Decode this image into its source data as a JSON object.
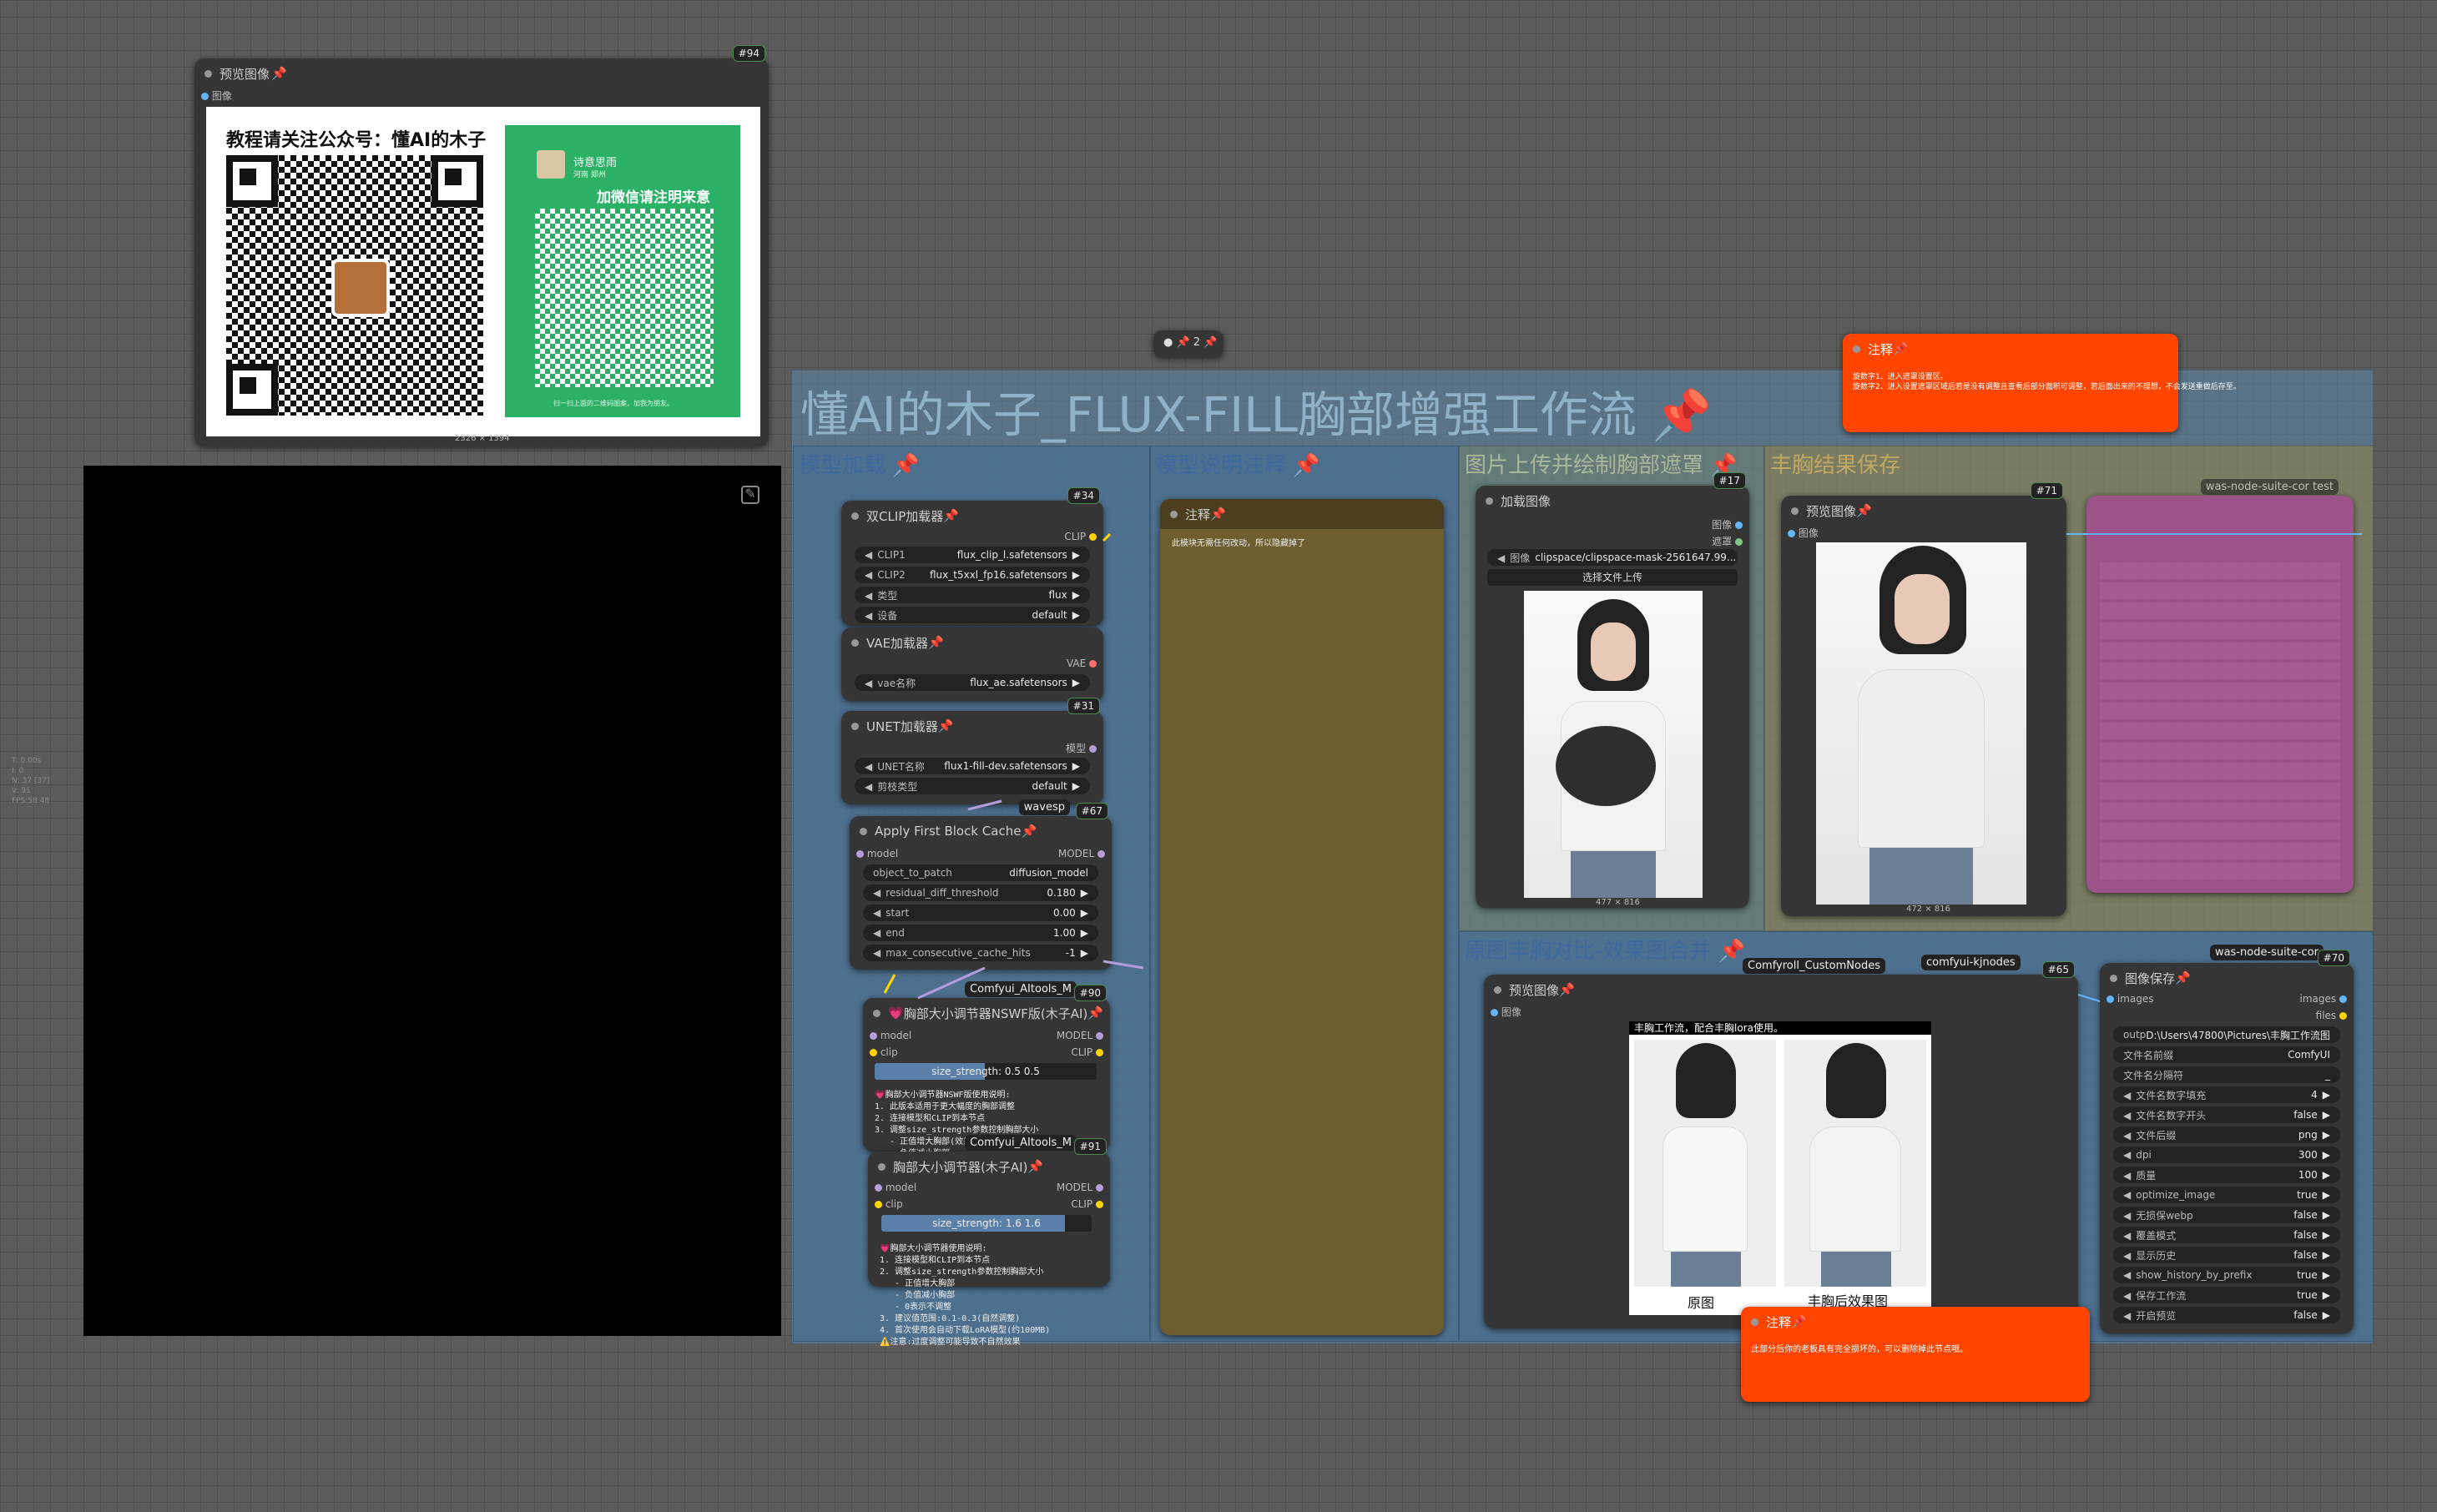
{
  "preview94": {
    "title": "预览图像",
    "badge": "#94",
    "input": "图像",
    "dims": "2326 × 1394",
    "qr_title": "教程请关注公众号：懂AI的木子",
    "wechat_name": "诗意思雨",
    "wechat_sub": "河南 郑州",
    "wechat_title": "加微信请注明来意",
    "wechat_hint": "扫一扫上面的二维码图案，加我为朋友。"
  },
  "pin_node": "2",
  "main_group": {
    "title": "懂AI的木子_FLUX-FILL胸部增强工作流"
  },
  "sub_groups": {
    "model": "模型加载",
    "note_group": "模型说明注释",
    "upload": "图片上传并绘制胸部遮罩",
    "result": "丰胸结果保存",
    "compare": "原图丰胸对比-效果图合并"
  },
  "note_top": {
    "title": "注释",
    "line1": "旋数字1、进入遮罩设置区。",
    "line2": "旋数字2、进入设置遮罩区域后若是没有调整且查看后部分面积可调整，若后面出来的不理想，不会发送重做后存至。"
  },
  "dual_clip": {
    "title": "双CLIP加载器",
    "badge": "#34",
    "output": "CLIP",
    "rows": [
      {
        "k": "CLIP1",
        "v": "flux_clip_l.safetensors"
      },
      {
        "k": "CLIP2",
        "v": "flux_t5xxl_fp16.safetensors"
      },
      {
        "k": "类型",
        "v": "flux"
      },
      {
        "k": "设备",
        "v": "default"
      }
    ]
  },
  "vae": {
    "title": "VAE加载器",
    "output": "VAE",
    "rows": [
      {
        "k": "vae名称",
        "v": "flux_ae.safetensors"
      }
    ]
  },
  "unet": {
    "title": "UNET加载器",
    "badge": "#31",
    "output": "模型",
    "rows": [
      {
        "k": "UNET名称",
        "v": "flux1-fill-dev.safetensors"
      },
      {
        "k": "剪枝类型",
        "v": "default"
      }
    ]
  },
  "fbc": {
    "title": "Apply First Block Cache",
    "tag": "wavesp",
    "badge": "#67",
    "input": "model",
    "output": "MODEL",
    "rows": [
      {
        "k": "object_to_patch",
        "v": "diffusion_model"
      },
      {
        "k": "residual_diff_threshold",
        "v": "0.180"
      },
      {
        "k": "start",
        "v": "0.00"
      },
      {
        "k": "end",
        "v": "1.00"
      },
      {
        "k": "max_consecutive_cache_hits",
        "v": "-1"
      }
    ]
  },
  "breast90": {
    "title": "胸部大小调节器NSWF版(木子AI)",
    "tag": "Comfyui_AItools_M",
    "badge": "#90",
    "in1": "model",
    "in2": "clip",
    "out1": "MODEL",
    "out2": "CLIP",
    "slider": "size_strength: 0.5  0.5",
    "notes": "💗胸部大小调节器NSWF版使用说明:\n1. 此版本适用于更大幅度的胸部调整\n2. 连接模型和CLIP到本节点\n3. 调整size_strength参数控制胸部大小\n   - 正值增大胸部(效果更明显)\n   - 负值减小胸部\n   - 0表示不调整\n4. 建议值范围:0.1-1.0\n5. 首次使用会自动下载LoRA模型\n⚠️注意:此版本调整幅度较大,请谨慎使用"
  },
  "breast91": {
    "title": "胸部大小调节器(木子AI)",
    "tag": "Comfyui_AItools_M",
    "badge": "#91",
    "in1": "model",
    "in2": "clip",
    "out1": "MODEL",
    "out2": "CLIP",
    "slider": "size_strength: 1.6  1.6",
    "notes": "💗胸部大小调节器使用说明:\n1. 连接模型和CLIP到本节点\n2. 调整size_strength参数控制胸部大小\n   - 正值增大胸部\n   - 负值减小胸部\n   - 0表示不调整\n3. 建议值范围:0.1-0.3(自然调整)\n4. 首次使用会自动下载LoRA模型(约100MB)\n⚠️注意:过度调整可能导致不自然效果"
  },
  "note_mid": {
    "title": "注释",
    "text": "此模块无需任何改动，所以隐藏掉了"
  },
  "load_image": {
    "title": "加载图像",
    "badge": "#17",
    "out1": "图像",
    "out2": "遮罩",
    "file": "clipspace/clipspace-mask-2561647.99...",
    "file_label": "图像",
    "upload_btn": "选择文件上传",
    "dims": "477 × 816"
  },
  "preview71": {
    "title": "预览图像",
    "badge": "#71",
    "input": "图像",
    "dims": "472 × 816",
    "tag": "was-node-suite-cor",
    "tag2": "test"
  },
  "preview65": {
    "title": "预览图像",
    "badge": "#65",
    "tag1": "Comfyroll_CustomNodes",
    "tag2": "comfyui-kjnodes",
    "input": "图像",
    "header": "丰胸工作流，配合丰胸lora使用。",
    "label_left": "原图",
    "label_right": "丰胸后效果图"
  },
  "save70": {
    "title": "图像保存",
    "badge": "#70",
    "tag": "was-node-suite-cor",
    "in1": "images",
    "out1": "images",
    "out2": "files",
    "rows": [
      {
        "k": "output_path",
        "v": "D:\\Users\\47800\\Pictures\\丰胸工作流图"
      },
      {
        "k": "文件名前缀",
        "v": "ComfyUI"
      },
      {
        "k": "文件名分隔符",
        "v": "_"
      },
      {
        "k": "文件名数字填充",
        "v": "4"
      },
      {
        "k": "文件名数字开头",
        "v": "false"
      },
      {
        "k": "文件后缀",
        "v": "png"
      },
      {
        "k": "dpi",
        "v": "300"
      },
      {
        "k": "质量",
        "v": "100"
      },
      {
        "k": "optimize_image",
        "v": "true"
      },
      {
        "k": "无损保webp",
        "v": "false"
      },
      {
        "k": "覆盖模式",
        "v": "false"
      },
      {
        "k": "显示历史",
        "v": "false"
      },
      {
        "k": "show_history_by_prefix",
        "v": "true"
      },
      {
        "k": "保存工作流",
        "v": "true"
      },
      {
        "k": "开启预览",
        "v": "false"
      }
    ]
  },
  "note_bottom": {
    "title": "注释",
    "text": "此部分后你的老板具有完全损坏的，可以删除掉此节点哦。"
  },
  "left_panel": {
    "l1": "T: 0.00s",
    "l2": "I: 0",
    "l3": "N: 37 [37]",
    "l4": "V: 91",
    "l5": "FPS:58.48"
  },
  "colors": {
    "canvas": "#5b5b5b",
    "node": "#353535",
    "orange": "#ff4500",
    "group_blue": "#3f6aa0",
    "group_olive": "#8a7a3a",
    "pink": "#a04a8a"
  }
}
